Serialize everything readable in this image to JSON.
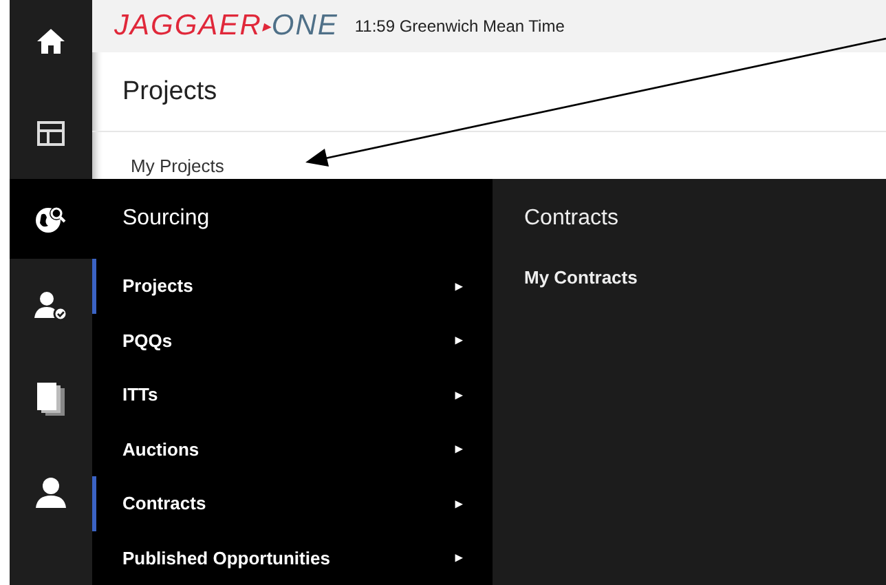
{
  "header": {
    "logo_primary": "JAGGAER",
    "logo_secondary": "ONE",
    "time": "11:59 Greenwich Mean Time"
  },
  "rail": [
    {
      "kind": "home",
      "selected": false
    },
    {
      "kind": "layout",
      "selected": false
    },
    {
      "kind": "globe",
      "selected": true
    },
    {
      "kind": "usercheck",
      "selected": false
    },
    {
      "kind": "documents",
      "selected": false
    },
    {
      "kind": "user",
      "selected": false
    }
  ],
  "page": {
    "title": "Projects",
    "breadcrumb": "My Projects"
  },
  "menu": {
    "title": "Sourcing",
    "items": [
      {
        "label": "Projects",
        "selected": true,
        "arrow": "▸"
      },
      {
        "label": "PQQs",
        "selected": false,
        "arrow": "▸"
      },
      {
        "label": "ITTs",
        "selected": false,
        "arrow": "▸"
      },
      {
        "label": "Auctions",
        "selected": false,
        "arrow": "▸"
      },
      {
        "label": "Contracts",
        "selected": true,
        "arrow": "▸"
      },
      {
        "label": "Published Opportunities",
        "selected": false,
        "arrow": "▸"
      }
    ]
  },
  "submenu": {
    "title": "Contracts",
    "items": [
      "My Contracts"
    ]
  }
}
